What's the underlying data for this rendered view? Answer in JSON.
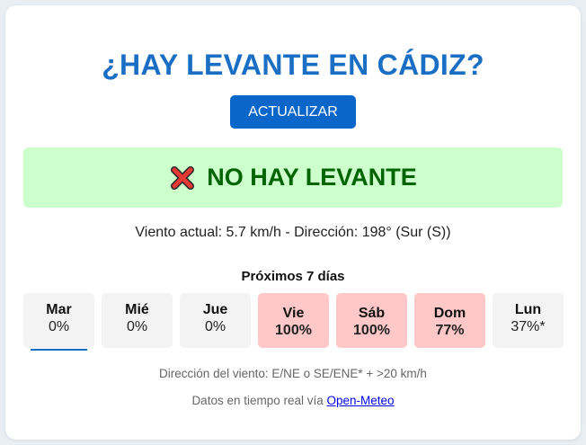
{
  "title": "¿HAY LEVANTE EN CÁDIZ?",
  "refresh_label": "ACTUALIZAR",
  "status": {
    "icon": "cross-mark-icon",
    "text": "NO HAY LEVANTE",
    "color": "#006400",
    "background": "#ccffcc"
  },
  "wind_current": "Viento actual: 5.7 km/h - Dirección: 198° (Sur (S))",
  "forecast_title": "Próximos 7 días",
  "days": [
    {
      "name": "Mar",
      "pct": "0%",
      "level": "low",
      "selected": true
    },
    {
      "name": "Mié",
      "pct": "0%",
      "level": "low"
    },
    {
      "name": "Jue",
      "pct": "0%",
      "level": "low"
    },
    {
      "name": "Vie",
      "pct": "100%",
      "level": "high"
    },
    {
      "name": "Sáb",
      "pct": "100%",
      "level": "high"
    },
    {
      "name": "Dom",
      "pct": "77%",
      "level": "high"
    },
    {
      "name": "Lun",
      "pct": "37%*",
      "level": "low"
    }
  ],
  "wind_rule": "Dirección del viento: E/NE o SE/ENE* + >20 km/h",
  "source": {
    "prefix": "Datos en tiempo real vía ",
    "link": "Open-Meteo"
  },
  "colors": {
    "accent": "#1a6fc4",
    "button": "#0a66c8",
    "high_day": "#ffc8c8",
    "low_day": "#f3f3f3"
  }
}
